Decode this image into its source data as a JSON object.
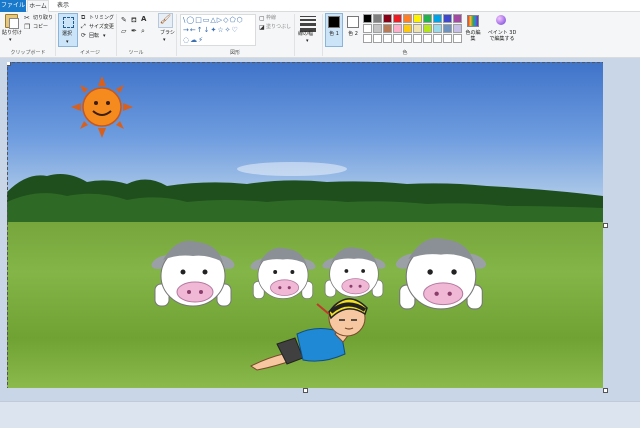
{
  "tabs": [
    {
      "label": "ファイル"
    },
    {
      "label": "ホーム"
    },
    {
      "label": "表示"
    }
  ],
  "ribbon": {
    "clipboard": {
      "paste": "貼り付け",
      "cut": "切り取り",
      "copy": "コピー",
      "group": "クリップボード"
    },
    "image": {
      "select": "選択",
      "crop": "トリミング",
      "resize": "サイズ変更",
      "rotate": "回転",
      "group": "イメージ"
    },
    "tools": {
      "text_glyph": "A",
      "group": "ツール"
    },
    "brushes": {
      "label": "ブラシ"
    },
    "shapes": {
      "outline": "枠線",
      "fill": "塗りつぶし",
      "group": "図形"
    },
    "size": {
      "label": "線の幅"
    },
    "colors": {
      "color1": "色 1",
      "color2": "色 2",
      "edit": "色の編集",
      "paint3d": "ペイント 3D で編集する",
      "group": "色",
      "color1_value": "#000000",
      "color2_value": "#ffffff",
      "palette_row1": [
        "#000000",
        "#7f7f7f",
        "#880015",
        "#ed1c24",
        "#ff7f27",
        "#fff200",
        "#22b14c",
        "#00a2e8",
        "#3f48cc",
        "#a349a4"
      ],
      "palette_row2": [
        "#ffffff",
        "#c3c3c3",
        "#b97a57",
        "#ffaec9",
        "#ffc90e",
        "#efe4b0",
        "#b5e61d",
        "#99d9ea",
        "#7092be",
        "#c8bfe7"
      ],
      "palette_row3": [
        "#ffffff",
        "#ffffff",
        "#ffffff",
        "#ffffff",
        "#ffffff",
        "#ffffff",
        "#ffffff",
        "#ffffff",
        "#ffffff",
        "#ffffff"
      ]
    }
  }
}
